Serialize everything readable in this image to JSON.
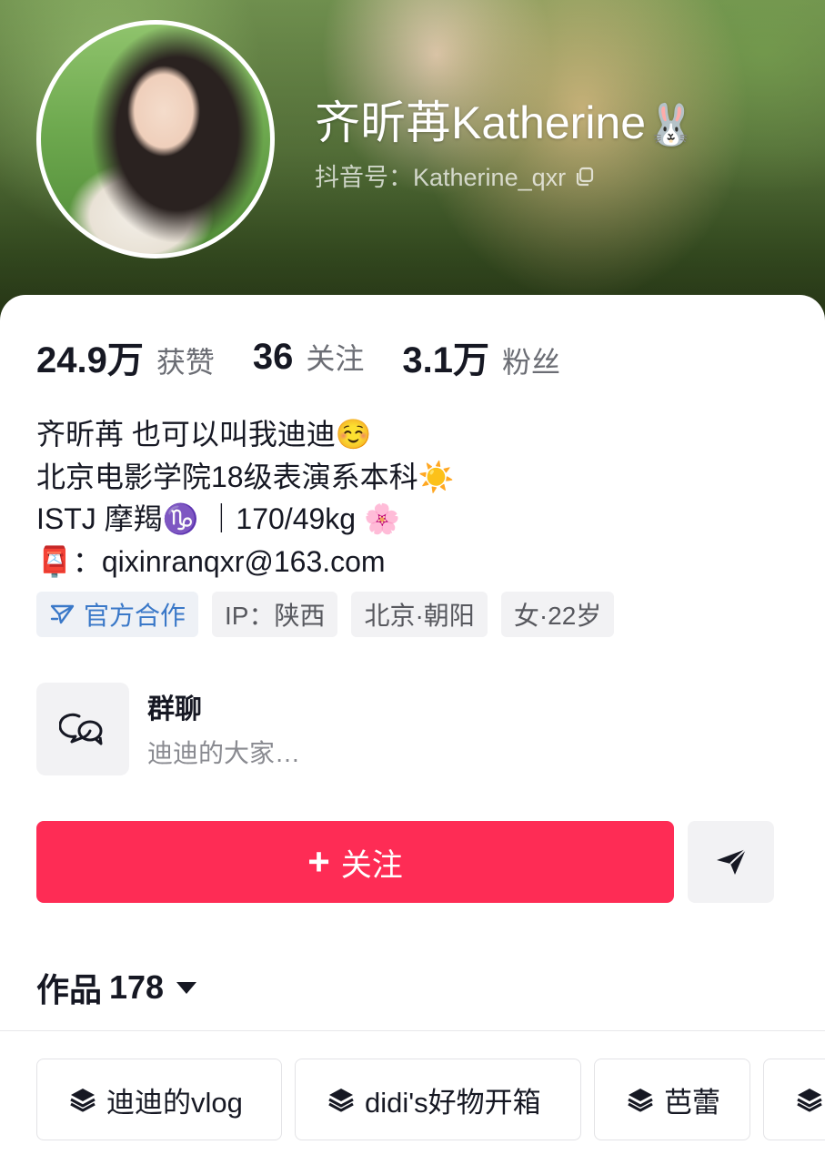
{
  "profile": {
    "display_name": "齐昕苒Katherine",
    "name_emoji": "🐰",
    "handle": "抖音号：Katherine_qxr"
  },
  "stats": [
    {
      "value": "24.9万",
      "label": "获赞"
    },
    {
      "value": "36",
      "label": "关注"
    },
    {
      "value": "3.1万",
      "label": "粉丝"
    }
  ],
  "bio": [
    "齐昕苒 也可以叫我迪迪☺️",
    "北京电影学院18级表演系本科☀️",
    "ISTJ 摩羯♑️ ｜170/49kg 🌸",
    "📮：qixinranqxr@163.com"
  ],
  "tags": {
    "official": "官方合作",
    "ip": "IP：陕西",
    "location": "北京·朝阳",
    "gender_age": "女·22岁"
  },
  "group_chat": {
    "title": "群聊",
    "subtitle": "迪迪的大家…"
  },
  "actions": {
    "follow_plus": "+",
    "follow_label": "关注"
  },
  "works": {
    "label": "作品",
    "count": "178"
  },
  "collections": [
    {
      "label": "迪迪的vlog"
    },
    {
      "label": "didi's好物开箱"
    },
    {
      "label": "芭蕾"
    },
    {
      "label": ""
    }
  ],
  "colors": {
    "accent": "#fe2c55",
    "official_blue": "#3a78c8",
    "chip_bg": "#f2f2f4"
  },
  "icons": {
    "copy": "copy-icon",
    "official": "official-partner-icon",
    "group": "chat-bubbles-icon",
    "share": "paper-plane-icon",
    "collection": "stack-layers-icon",
    "works_dropdown": "caret-down-icon"
  }
}
